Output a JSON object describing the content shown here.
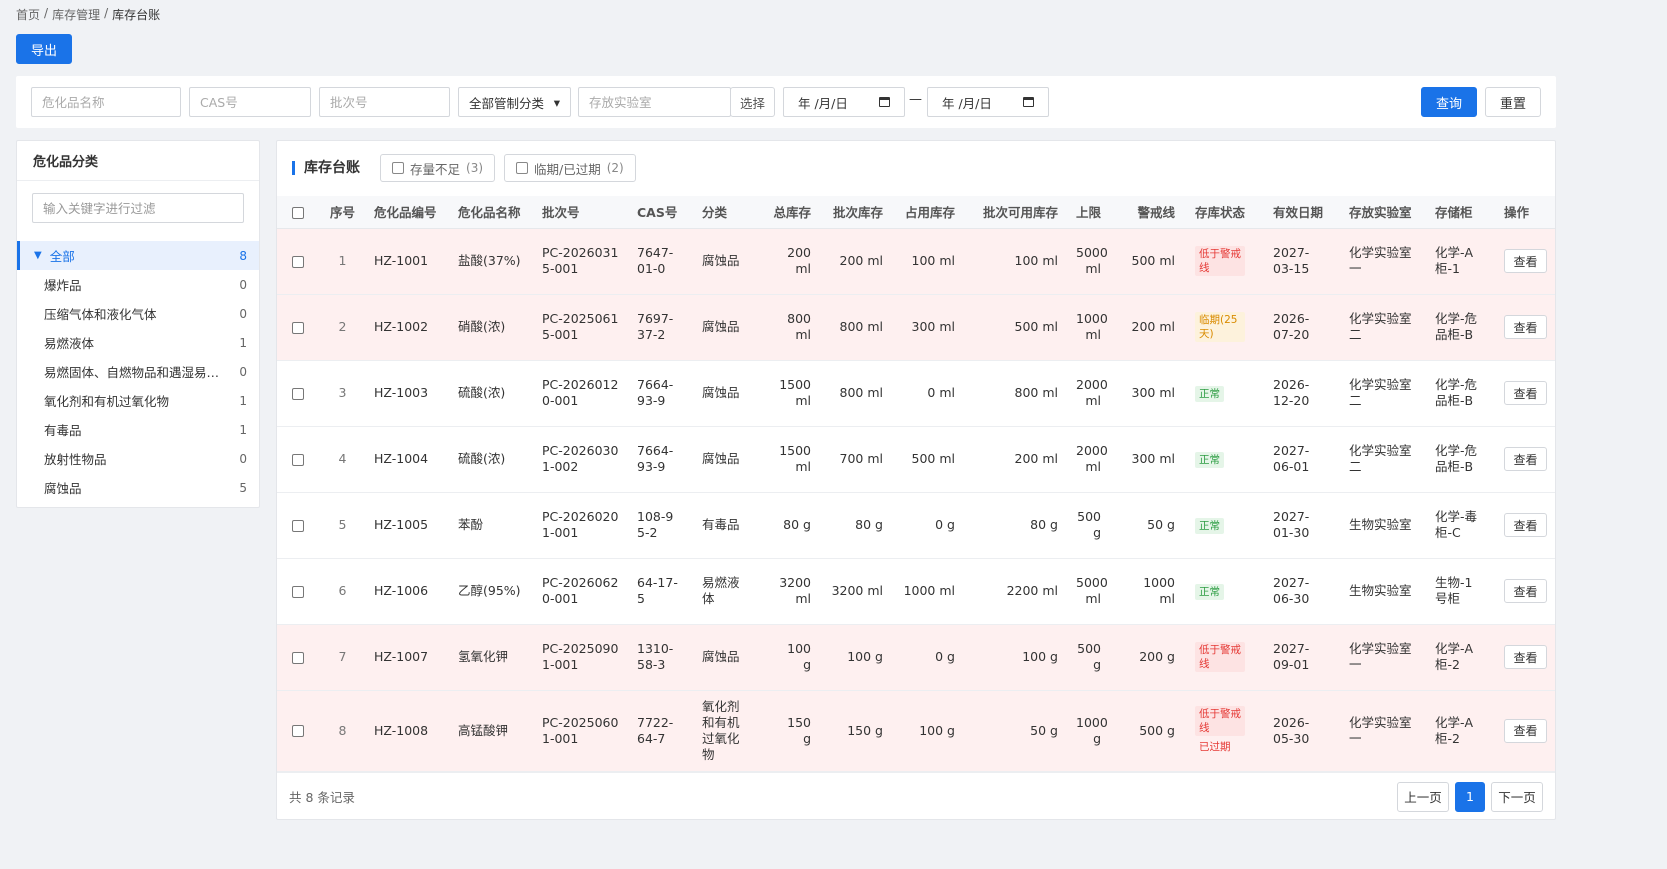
{
  "breadcrumb": {
    "items": [
      "首页",
      "库存管理",
      "库存台账"
    ],
    "sep": "/"
  },
  "toolbar": {
    "export_label": "导出"
  },
  "filters": {
    "name_placeholder": "危化品名称",
    "cas_placeholder": "CAS号",
    "batch_placeholder": "批次号",
    "category_value": "全部管制分类",
    "lab_placeholder": "存放实验室",
    "lab_select_label": "选择",
    "date_start": "年 /月/日",
    "date_sep": "—",
    "date_end": "年 /月/日",
    "query_label": "查询",
    "reset_label": "重置"
  },
  "sidebar": {
    "title": "危化品分类",
    "search_placeholder": "输入关键字进行过滤",
    "root": {
      "label": "全部",
      "count": "8"
    },
    "items": [
      {
        "label": "爆炸品",
        "count": "0"
      },
      {
        "label": "压缩气体和液化气体",
        "count": "0"
      },
      {
        "label": "易燃液体",
        "count": "1"
      },
      {
        "label": "易燃固体、自燃物品和遇湿易燃物品",
        "count": "0"
      },
      {
        "label": "氧化剂和有机过氧化物",
        "count": "1"
      },
      {
        "label": "有毒品",
        "count": "1"
      },
      {
        "label": "放射性物品",
        "count": "0"
      },
      {
        "label": "腐蚀品",
        "count": "5"
      }
    ]
  },
  "main": {
    "title": "库存台账",
    "chips": [
      {
        "label": "存量不足",
        "count": "(3)"
      },
      {
        "label": "临期/已过期",
        "count": "(2)"
      }
    ],
    "columns": [
      "序号",
      "危化品编号",
      "危化品名称",
      "批次号",
      "CAS号",
      "分类",
      "总库存",
      "批次库存",
      "占用库存",
      "批次可用库存",
      "上限",
      "警戒线",
      "存库状态",
      "有效日期",
      "存放实验室",
      "存储柜",
      "操作"
    ],
    "rows": [
      {
        "seq": "1",
        "code": "HZ-1001",
        "name": "盐酸(37%)",
        "batch": "PC-20260315-001",
        "cas": "7647-01-0",
        "cat": "腐蚀品",
        "total": "200 ml",
        "batch_stock": "200 ml",
        "occupied": "100 ml",
        "available": "100 ml",
        "upper": "5000 ml",
        "warn": "500 ml",
        "tags": [
          {
            "text": "低于警戒线",
            "type": "low"
          }
        ],
        "expire": "2027-03-15",
        "lab": "化学实验室一",
        "cabinet": "化学-A柜-1",
        "action": "查看",
        "warn_row": true
      },
      {
        "seq": "2",
        "code": "HZ-1002",
        "name": "硝酸(浓)",
        "batch": "PC-20250615-001",
        "cas": "7697-37-2",
        "cat": "腐蚀品",
        "total": "800 ml",
        "batch_stock": "800 ml",
        "occupied": "300 ml",
        "available": "500 ml",
        "upper": "1000 ml",
        "warn": "200 ml",
        "tags": [
          {
            "text": "临期(25天)",
            "type": "near"
          }
        ],
        "expire": "2026-07-20",
        "lab": "化学实验室二",
        "cabinet": "化学-危品柜-B",
        "action": "查看",
        "warn_row": true
      },
      {
        "seq": "3",
        "code": "HZ-1003",
        "name": "硫酸(浓)",
        "batch": "PC-20260120-001",
        "cas": "7664-93-9",
        "cat": "腐蚀品",
        "total": "1500 ml",
        "batch_stock": "800 ml",
        "occupied": "0 ml",
        "available": "800 ml",
        "upper": "2000 ml",
        "warn": "300 ml",
        "tags": [
          {
            "text": "正常",
            "type": "ok"
          }
        ],
        "expire": "2026-12-20",
        "lab": "化学实验室二",
        "cabinet": "化学-危品柜-B",
        "action": "查看",
        "warn_row": false
      },
      {
        "seq": "4",
        "code": "HZ-1004",
        "name": "硫酸(浓)",
        "batch": "PC-20260301-002",
        "cas": "7664-93-9",
        "cat": "腐蚀品",
        "total": "1500 ml",
        "batch_stock": "700 ml",
        "occupied": "500 ml",
        "available": "200 ml",
        "upper": "2000 ml",
        "warn": "300 ml",
        "tags": [
          {
            "text": "正常",
            "type": "ok"
          }
        ],
        "expire": "2027-06-01",
        "lab": "化学实验室二",
        "cabinet": "化学-危品柜-B",
        "action": "查看",
        "warn_row": false
      },
      {
        "seq": "5",
        "code": "HZ-1005",
        "name": "苯酚",
        "batch": "PC-20260201-001",
        "cas": "108-95-2",
        "cat": "有毒品",
        "total": "80 g",
        "batch_stock": "80 g",
        "occupied": "0 g",
        "available": "80 g",
        "upper": "500 g",
        "warn": "50 g",
        "tags": [
          {
            "text": "正常",
            "type": "ok"
          }
        ],
        "expire": "2027-01-30",
        "lab": "生物实验室",
        "cabinet": "化学-毒柜-C",
        "action": "查看",
        "warn_row": false
      },
      {
        "seq": "6",
        "code": "HZ-1006",
        "name": "乙醇(95%)",
        "batch": "PC-20260620-001",
        "cas": "64-17-5",
        "cat": "易燃液体",
        "total": "3200 ml",
        "batch_stock": "3200 ml",
        "occupied": "1000 ml",
        "available": "2200 ml",
        "upper": "5000 ml",
        "warn": "1000 ml",
        "tags": [
          {
            "text": "正常",
            "type": "ok"
          }
        ],
        "expire": "2027-06-30",
        "lab": "生物实验室",
        "cabinet": "生物-1号柜",
        "action": "查看",
        "warn_row": false
      },
      {
        "seq": "7",
        "code": "HZ-1007",
        "name": "氢氧化钾",
        "batch": "PC-20250901-001",
        "cas": "1310-58-3",
        "cat": "腐蚀品",
        "total": "100 g",
        "batch_stock": "100 g",
        "occupied": "0 g",
        "available": "100 g",
        "upper": "500 g",
        "warn": "200 g",
        "tags": [
          {
            "text": "低于警戒线",
            "type": "low"
          }
        ],
        "expire": "2027-09-01",
        "lab": "化学实验室一",
        "cabinet": "化学-A柜-2",
        "action": "查看",
        "warn_row": true
      },
      {
        "seq": "8",
        "code": "HZ-1008",
        "name": "高锰酸钾",
        "batch": "PC-20250601-001",
        "cas": "7722-64-7",
        "cat": "氧化剂和有机过氧化物",
        "total": "150 g",
        "batch_stock": "150 g",
        "occupied": "100 g",
        "available": "50 g",
        "upper": "1000 g",
        "warn": "500 g",
        "tags": [
          {
            "text": "低于警戒线",
            "type": "low"
          },
          {
            "text": "已过期",
            "type": "exp"
          }
        ],
        "expire": "2026-05-30",
        "lab": "化学实验室一",
        "cabinet": "化学-A柜-2",
        "action": "查看",
        "warn_row": true
      }
    ],
    "total_text": "共 8 条记录",
    "pager": {
      "prev": "上一页",
      "page": "1",
      "next": "下一页"
    }
  }
}
